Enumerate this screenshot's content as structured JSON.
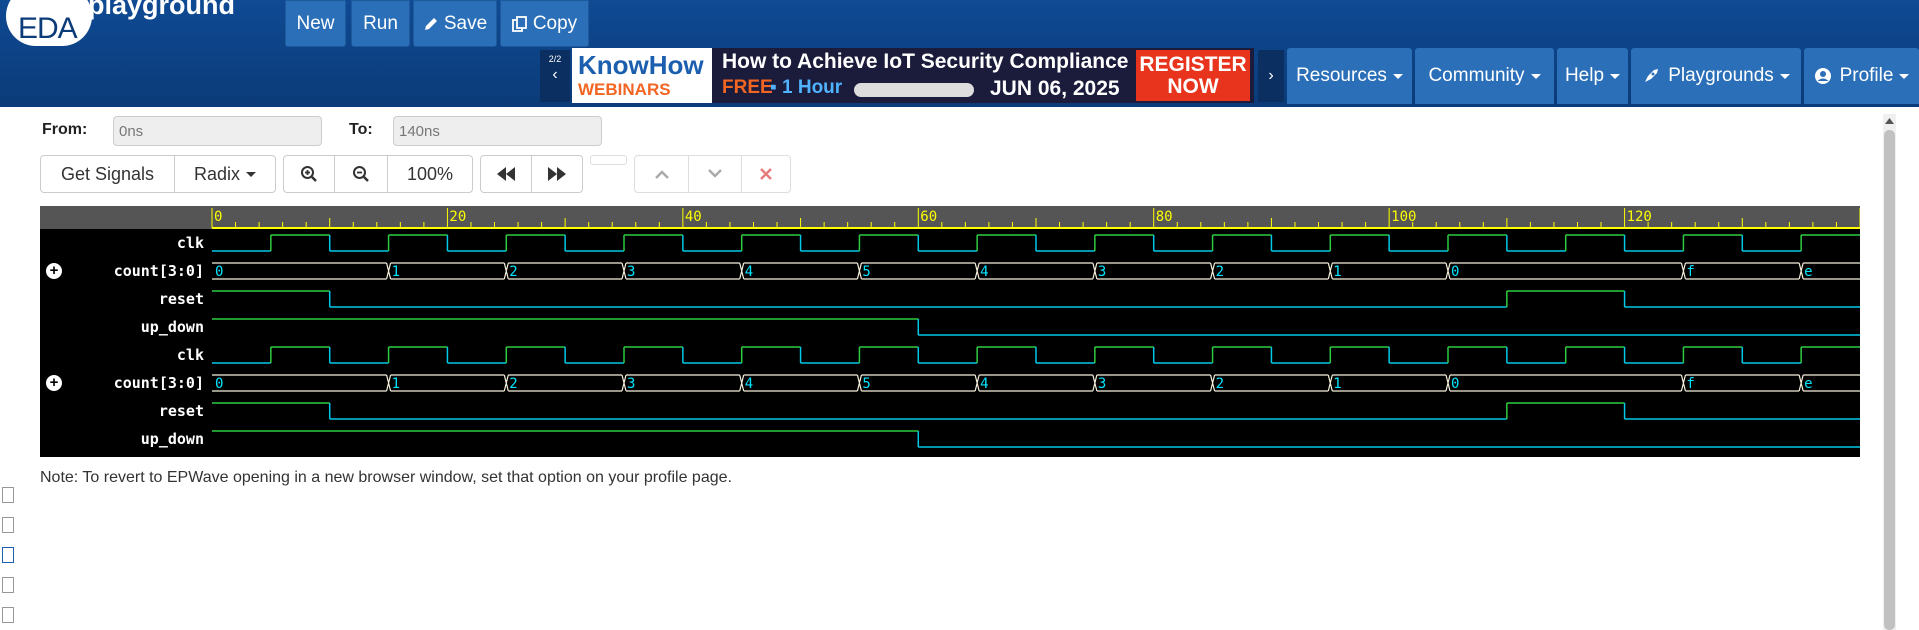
{
  "header": {
    "logo_text": "EDA",
    "logo_sub": "playground",
    "buttons": {
      "new": "New",
      "run": "Run",
      "save": "Save",
      "copy": "Copy"
    }
  },
  "banner": {
    "page": "2/2",
    "brand_1": "KnowHow",
    "brand_2": "WEBINARS",
    "title": "How to Achieve IoT Security Compliance",
    "free": "FREE",
    "hour": "▪ 1 Hour",
    "date": "JUN 06, 2025",
    "cta": "REGISTER NOW"
  },
  "nav": {
    "resources": "Resources",
    "community": "Community",
    "help": "Help",
    "playgrounds": "Playgrounds",
    "profile": "Profile"
  },
  "controls": {
    "from_label": "From:",
    "from_value": "0ns",
    "to_label": "To:",
    "to_value": "140ns",
    "get_signals": "Get Signals",
    "radix": "Radix",
    "zoom_level": "100%"
  },
  "waveform": {
    "timeline": {
      "start": 0,
      "end": 140,
      "labels": [
        "0",
        "20",
        "40",
        "60",
        "80",
        "100",
        "120"
      ]
    },
    "clock_period": 10,
    "signals": [
      {
        "name": "clk",
        "type": "clock"
      },
      {
        "name": "count[3:0]",
        "type": "bus",
        "expandable": true,
        "segments": [
          [
            0,
            "0"
          ],
          [
            15,
            "1"
          ],
          [
            25,
            "2"
          ],
          [
            35,
            "3"
          ],
          [
            45,
            "4"
          ],
          [
            55,
            "5"
          ],
          [
            65,
            "4"
          ],
          [
            75,
            "3"
          ],
          [
            85,
            "2"
          ],
          [
            95,
            "1"
          ],
          [
            105,
            "0"
          ],
          [
            125,
            "f"
          ],
          [
            135,
            "e"
          ]
        ]
      },
      {
        "name": "reset",
        "type": "bit",
        "edges": [
          [
            0,
            1
          ],
          [
            10,
            0
          ],
          [
            110,
            1
          ],
          [
            120,
            0
          ]
        ]
      },
      {
        "name": "up_down",
        "type": "bit",
        "edges": [
          [
            0,
            1
          ],
          [
            60,
            0
          ]
        ]
      },
      {
        "name": "clk",
        "type": "clock"
      },
      {
        "name": "count[3:0]",
        "type": "bus",
        "expandable": true,
        "segments": [
          [
            0,
            "0"
          ],
          [
            15,
            "1"
          ],
          [
            25,
            "2"
          ],
          [
            35,
            "3"
          ],
          [
            45,
            "4"
          ],
          [
            55,
            "5"
          ],
          [
            65,
            "4"
          ],
          [
            75,
            "3"
          ],
          [
            85,
            "2"
          ],
          [
            95,
            "1"
          ],
          [
            105,
            "0"
          ],
          [
            125,
            "f"
          ],
          [
            135,
            "e"
          ]
        ]
      },
      {
        "name": "reset",
        "type": "bit",
        "edges": [
          [
            0,
            1
          ],
          [
            10,
            0
          ],
          [
            110,
            1
          ],
          [
            120,
            0
          ]
        ]
      },
      {
        "name": "up_down",
        "type": "bit",
        "edges": [
          [
            0,
            1
          ],
          [
            60,
            0
          ]
        ]
      }
    ]
  },
  "note": "Note: To revert to EPWave opening in a new browser window, set that option on your profile page.",
  "colors": {
    "high": "#2ecc40",
    "low": "#00c8e8",
    "bus": "#f5f0dc",
    "bus_text": "#00e5ff",
    "ruler": "#ffff00"
  }
}
